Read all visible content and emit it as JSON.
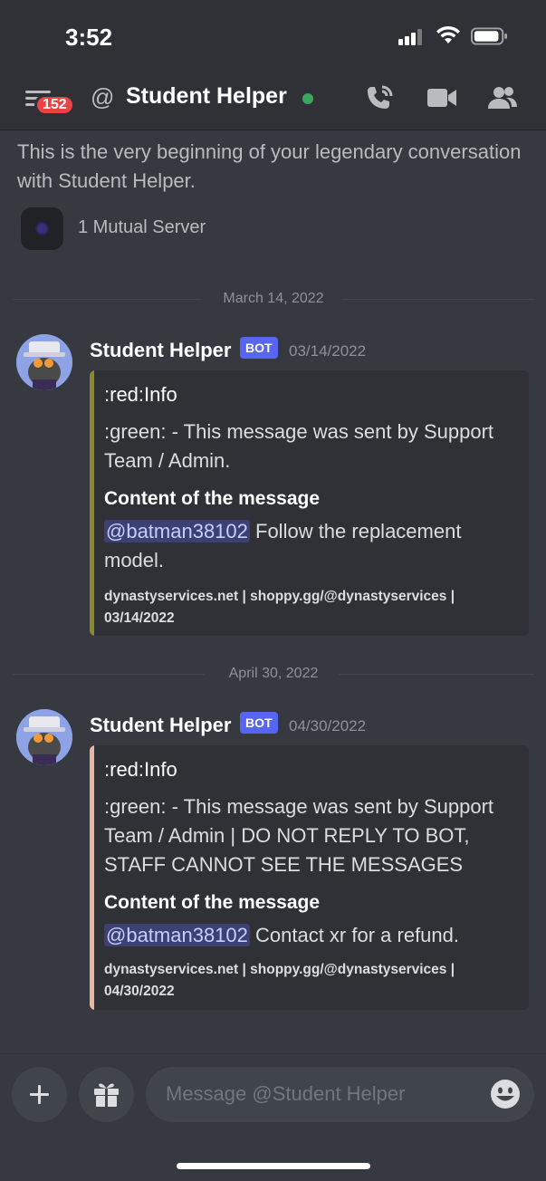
{
  "status_bar": {
    "time": "3:52"
  },
  "header": {
    "unread_count": "152",
    "title": "Student Helper",
    "icons": [
      "menu-icon",
      "at-icon",
      "call-icon",
      "video-icon",
      "members-icon"
    ]
  },
  "intro": {
    "text": "This is the very beginning of your legendary conversation with Student Helper.",
    "mutual_servers": "1 Mutual Server"
  },
  "messages": [
    {
      "date_divider": "March 14, 2022",
      "author": "Student Helper",
      "tag": "BOT",
      "timestamp": "03/14/2022",
      "embed": {
        "color": "#8b8b2b",
        "title": ":red:Info",
        "description": ":green: - This message was sent by Support Team / Admin.",
        "field_name": "Content of the message",
        "mention": "@batman38102",
        "field_value": " Follow the replacement model.",
        "footer": "dynastyservices.net | shoppy.gg/@dynastyservices | 03/14/2022"
      }
    },
    {
      "date_divider": "April 30, 2022",
      "author": "Student Helper",
      "tag": "BOT",
      "timestamp": "04/30/2022",
      "embed": {
        "color": "#e8b7a3",
        "title": ":red:Info",
        "description": ":green: - This message was sent by Support Team / Admin | DO NOT REPLY TO BOT, STAFF CANNOT SEE THE MESSAGES",
        "field_name": "Content of the message",
        "mention": "@batman38102",
        "field_value": " Contact xr for a refund.",
        "footer": "dynastyservices.net | shoppy.gg/@dynastyservices | 04/30/2022"
      }
    }
  ],
  "composer": {
    "placeholder": "Message @Student Helper",
    "icons": [
      "plus-icon",
      "gift-icon",
      "emoji-icon"
    ]
  },
  "colors": {
    "background": "#36393f",
    "header": "#2f3136",
    "blurple": "#5865f2",
    "online": "#3ba55d",
    "badge": "#ed4245"
  }
}
